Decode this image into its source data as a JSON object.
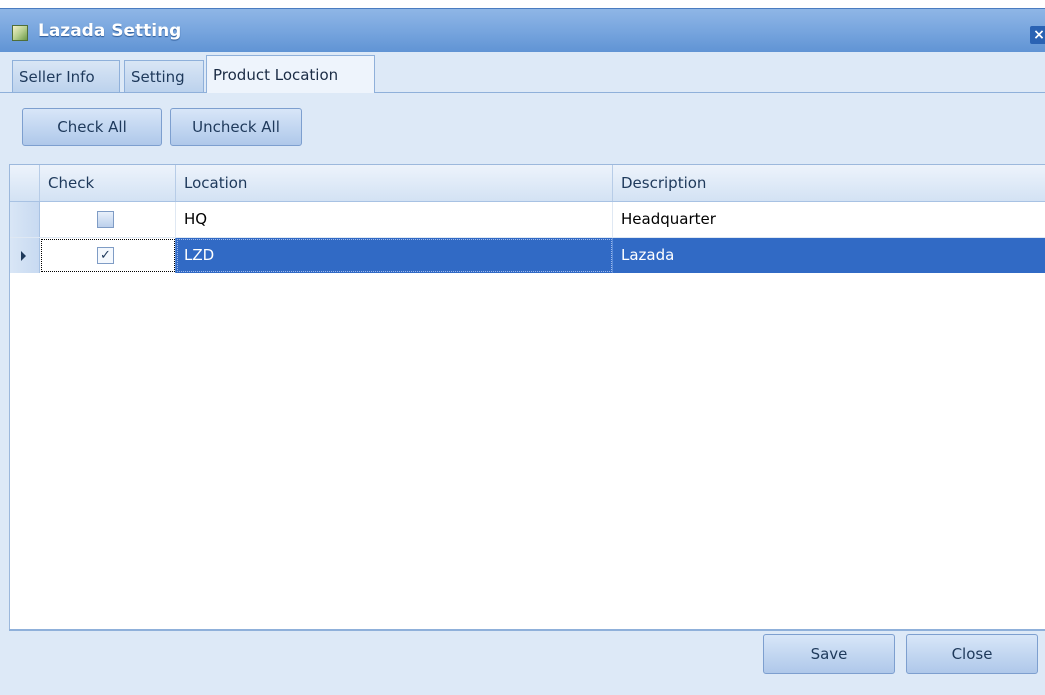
{
  "window": {
    "title": "Lazada Setting",
    "close_label": "×"
  },
  "tabs": [
    {
      "label": "Seller Info",
      "active": false
    },
    {
      "label": "Setting",
      "active": false
    },
    {
      "label": "Product Location",
      "active": true
    }
  ],
  "toolbar": {
    "check_all_label": "Check All",
    "uncheck_all_label": "Uncheck All"
  },
  "grid": {
    "columns": [
      "Check",
      "Location",
      "Description"
    ],
    "rows": [
      {
        "checked": false,
        "location": "HQ",
        "description": "Headquarter",
        "selected": false
      },
      {
        "checked": true,
        "location": "LZD",
        "description": "Lazada",
        "selected": true
      }
    ],
    "check_mark": "✓"
  },
  "footer": {
    "save_label": "Save",
    "close_label": "Close"
  },
  "colors": {
    "title_bar": "#7aa7df",
    "selected_row": "#316ac5",
    "panel_background": "#dde9f7"
  }
}
